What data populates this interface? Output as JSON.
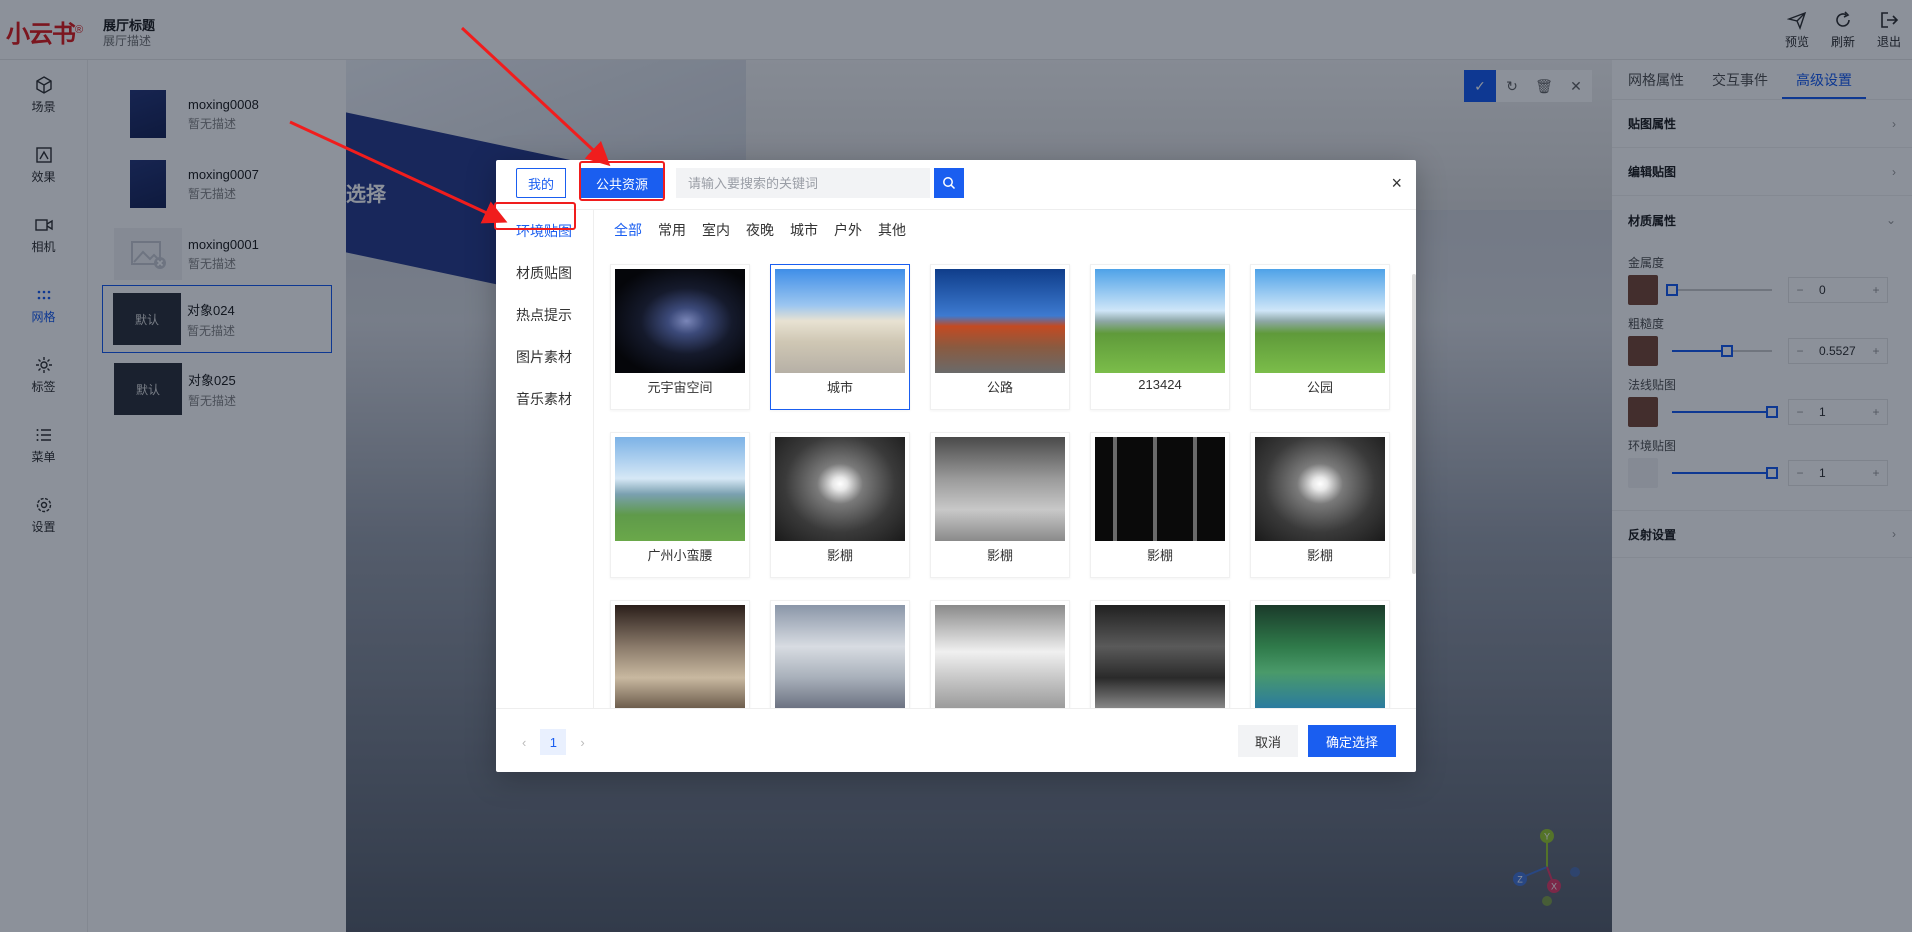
{
  "app": {
    "logo": "小云书",
    "logo_mark": "®"
  },
  "header": {
    "title": "展厅标题",
    "desc": "展厅描述",
    "actions": [
      {
        "label": "预览",
        "icon": "send-icon"
      },
      {
        "label": "刷新",
        "icon": "refresh-icon"
      },
      {
        "label": "退出",
        "icon": "exit-icon"
      }
    ]
  },
  "leftnav": {
    "items": [
      {
        "label": "场景",
        "icon": "cube-icon"
      },
      {
        "label": "效果",
        "icon": "effect-icon"
      },
      {
        "label": "相机",
        "icon": "camera-icon"
      },
      {
        "label": "网格",
        "icon": "grid-icon",
        "active": true
      },
      {
        "label": "标签",
        "icon": "tag-icon"
      },
      {
        "label": "菜单",
        "icon": "menu-icon"
      },
      {
        "label": "设置",
        "icon": "settings-icon"
      }
    ]
  },
  "objects": [
    {
      "name": "moxing0008",
      "desc": "暂无描述",
      "thumb": "book"
    },
    {
      "name": "moxing0007",
      "desc": "暂无描述",
      "thumb": "book"
    },
    {
      "name": "moxing0001",
      "desc": "暂无描述",
      "thumb": "noimg"
    },
    {
      "name": "对象024",
      "desc": "暂无描述",
      "thumb": "默认",
      "selected": true
    },
    {
      "name": "对象025",
      "desc": "暂无描述",
      "thumb": "默认"
    }
  ],
  "viewport": {
    "banner_text": "选择",
    "gizmo_axes": [
      "Y",
      "Z",
      "X"
    ]
  },
  "props": {
    "tabs": [
      "网格属性",
      "交互事件",
      "高级设置"
    ],
    "active_tab": "高级设置",
    "sections": {
      "texture": "贴图属性",
      "edit": "编辑贴图",
      "material": "材质属性",
      "reflect": "反射设置"
    },
    "metal": {
      "label": "金属度",
      "value": "0",
      "level": 0.0
    },
    "rough": {
      "label": "粗糙度",
      "value": "0.5527",
      "level": 0.5527
    },
    "normal": {
      "label": "法线贴图",
      "value": "1",
      "level": 1.0
    },
    "env": {
      "label": "环境贴图",
      "value": "1",
      "level": 1.0
    }
  },
  "modal": {
    "tab_mine": "我的",
    "tab_public": "公共资源",
    "search_placeholder": "请输入要搜索的关键词",
    "categories": [
      "环境贴图",
      "材质贴图",
      "热点提示",
      "图片素材",
      "音乐素材"
    ],
    "active_category": "环境贴图",
    "filters": [
      "全部",
      "常用",
      "室内",
      "夜晚",
      "城市",
      "户外",
      "其他"
    ],
    "active_filter": "全部",
    "items": [
      {
        "name": "元宇宙空间",
        "style": "space"
      },
      {
        "name": "城市",
        "style": "city",
        "selected": true
      },
      {
        "name": "公路",
        "style": "road"
      },
      {
        "name": "213424",
        "style": "park"
      },
      {
        "name": "公园",
        "style": "park"
      },
      {
        "name": "广州小蛮腰",
        "style": "gz"
      },
      {
        "name": "影棚",
        "style": "studio1"
      },
      {
        "name": "影棚",
        "style": "studio2"
      },
      {
        "name": "影棚",
        "style": "studio3"
      },
      {
        "name": "影棚",
        "style": "studio1"
      },
      {
        "name": "",
        "style": "mall"
      },
      {
        "name": "",
        "style": "glass"
      },
      {
        "name": "",
        "style": "hall"
      },
      {
        "name": "",
        "style": "dark"
      },
      {
        "name": "",
        "style": "green"
      }
    ],
    "pager": {
      "prev": "‹",
      "current": "1",
      "next": "›"
    },
    "cancel": "取消",
    "confirm": "确定选择",
    "close": "×"
  },
  "colors": {
    "accent": "#1a5ef0",
    "annotation": "#f01d1d"
  }
}
